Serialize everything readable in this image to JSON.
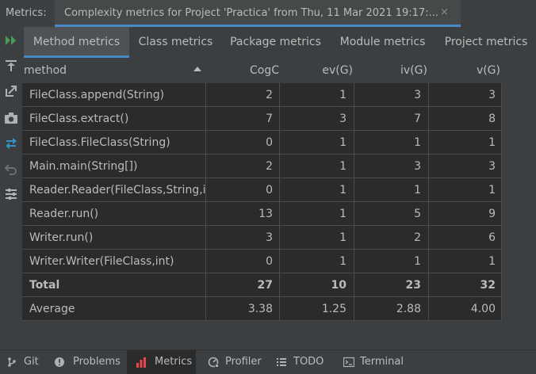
{
  "header": {
    "label": "Metrics:",
    "tab_title": "Complexity metrics for Project 'Practica' from Thu, 11 Mar 2021 19:17:...",
    "close_glyph": "×"
  },
  "toolbar_icons": [
    "run-icon",
    "export-icon",
    "export-snapshot-icon",
    "camera-icon",
    "compare-icon",
    "undo-icon",
    "settings-icon"
  ],
  "tabs": [
    {
      "label": "Method metrics",
      "active": true
    },
    {
      "label": "Class metrics"
    },
    {
      "label": "Package metrics"
    },
    {
      "label": "Module metrics"
    },
    {
      "label": "Project metrics"
    }
  ],
  "table": {
    "columns": [
      "method",
      "CogC",
      "ev(G)",
      "iv(G)",
      "v(G)"
    ],
    "sorted_by": "method",
    "rows": [
      [
        "FileClass.append(String)",
        "2",
        "1",
        "3",
        "3"
      ],
      [
        "FileClass.extract()",
        "7",
        "3",
        "7",
        "8"
      ],
      [
        "FileClass.FileClass(String)",
        "0",
        "1",
        "1",
        "1"
      ],
      [
        "Main.main(String[])",
        "2",
        "1",
        "3",
        "3"
      ],
      [
        "Reader.Reader(FileClass,String,int",
        "0",
        "1",
        "1",
        "1"
      ],
      [
        "Reader.run()",
        "13",
        "1",
        "5",
        "9"
      ],
      [
        "Writer.run()",
        "3",
        "1",
        "2",
        "6"
      ],
      [
        "Writer.Writer(FileClass,int)",
        "0",
        "1",
        "1",
        "1"
      ],
      [
        "Total",
        "27",
        "10",
        "23",
        "32"
      ],
      [
        "Average",
        "3.38",
        "1.25",
        "2.88",
        "4.00"
      ]
    ]
  },
  "bottom_bar": [
    {
      "label": "Git",
      "icon": "git-icon"
    },
    {
      "label": "Problems",
      "icon": "problems-icon"
    },
    {
      "label": "Metrics",
      "icon": "metrics-icon",
      "active": true
    },
    {
      "label": "Profiler",
      "icon": "profiler-icon"
    },
    {
      "label": "TODO",
      "icon": "todo-icon"
    },
    {
      "label": "Terminal",
      "icon": "terminal-icon"
    }
  ],
  "colors": {
    "accent": "#4a88c7",
    "run_green": "#499c54",
    "metrics_red": "#e5484d",
    "compare_blue": "#3592c4"
  }
}
